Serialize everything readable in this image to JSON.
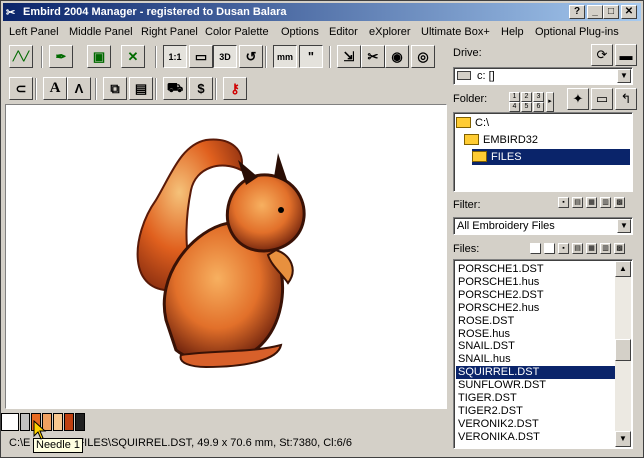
{
  "window": {
    "title": "Embird 2004 Manager - registered to Dusan Balara",
    "controls": {
      "help": "?",
      "minimize": "_",
      "maximize": "□",
      "close": "✕"
    }
  },
  "menu": [
    "Left Panel",
    "Middle Panel",
    "Right Panel",
    "Color Palette",
    "Options",
    "Editor",
    "eXplorer",
    "Ultimate Box+",
    "Help",
    "Optional Plug-ins"
  ],
  "toolbar": {
    "row1": [
      {
        "name": "stitch-view-icon",
        "glyph": "╱╲╱"
      },
      {
        "name": "needle-pen-icon",
        "glyph": "✒"
      },
      {
        "name": "camera-icon",
        "glyph": "▣"
      },
      {
        "name": "needle-grid-icon",
        "glyph": "✕"
      },
      {
        "name": "view-1to1-icon",
        "glyph": "1:1"
      },
      {
        "name": "monitor-icon",
        "glyph": "▭"
      },
      {
        "name": "view-3d-icon",
        "glyph": "3D"
      },
      {
        "name": "redraw-icon",
        "glyph": "↺"
      },
      {
        "name": "ruler-mm-icon",
        "glyph": "mm"
      },
      {
        "name": "ruler-inch-icon",
        "glyph": "\""
      },
      {
        "name": "export-icon",
        "glyph": "⇲"
      },
      {
        "name": "scissors-icon",
        "glyph": "✂"
      },
      {
        "name": "eye-needle-icon",
        "glyph": "◉"
      },
      {
        "name": "eye-thread-icon",
        "glyph": "◎"
      }
    ],
    "row2": [
      {
        "name": "hoop-icon",
        "glyph": "⊂"
      },
      {
        "name": "lettering-icon",
        "glyph": "A"
      },
      {
        "name": "font-edit-icon",
        "glyph": "Ʌ"
      },
      {
        "name": "copy-icon",
        "glyph": "⧉"
      },
      {
        "name": "pages-icon",
        "glyph": "▤"
      },
      {
        "name": "cart-icon",
        "glyph": "⛟"
      },
      {
        "name": "money-bag-icon",
        "glyph": "$"
      },
      {
        "name": "key-icon",
        "glyph": "⚷"
      }
    ]
  },
  "right_panel": {
    "drive_label": "Drive:",
    "drive_value": "c: []",
    "folder_label": "Folder:",
    "folder_grid": [
      "1",
      "2",
      "3",
      "4",
      "5",
      "6"
    ],
    "folders": [
      {
        "label": "C:\\",
        "indent": 0,
        "selected": false
      },
      {
        "label": "EMBIRD32",
        "indent": 1,
        "selected": false
      },
      {
        "label": "FILES",
        "indent": 2,
        "selected": true
      }
    ],
    "filter_label": "Filter:",
    "filter_value": "All Embroidery Files",
    "files_label": "Files:",
    "files": [
      {
        "name": "PORSCHE1.DST",
        "selected": false
      },
      {
        "name": "PORSCHE1.hus",
        "selected": false
      },
      {
        "name": "PORSCHE2.DST",
        "selected": false
      },
      {
        "name": "PORSCHE2.hus",
        "selected": false
      },
      {
        "name": "ROSE.DST",
        "selected": false
      },
      {
        "name": "ROSE.hus",
        "selected": false
      },
      {
        "name": "SNAIL.DST",
        "selected": false
      },
      {
        "name": "SNAIL.hus",
        "selected": false
      },
      {
        "name": "SQUIRREL.DST",
        "selected": true
      },
      {
        "name": "SUNFLOWR.DST",
        "selected": false
      },
      {
        "name": "TIGER.DST",
        "selected": false
      },
      {
        "name": "TIGER2.DST",
        "selected": false
      },
      {
        "name": "VERONIK2.DST",
        "selected": false
      },
      {
        "name": "VERONIKA.DST",
        "selected": false
      }
    ]
  },
  "palette": {
    "colors": [
      "#ffffff",
      "#c0c0c0",
      "#e86a20",
      "#f0a060",
      "#f8c890",
      "#c04010",
      "#202020"
    ]
  },
  "tooltip": "Needle 1",
  "status": {
    "left": "C:\\E",
    "right": "\\FILES\\SQUIRREL.DST, 49.9 x 70.6 mm, St:7380, Cl:6/6"
  },
  "colors": {
    "selection": "#0a246a",
    "title_start": "#0a246a",
    "title_end": "#a6caf0"
  }
}
